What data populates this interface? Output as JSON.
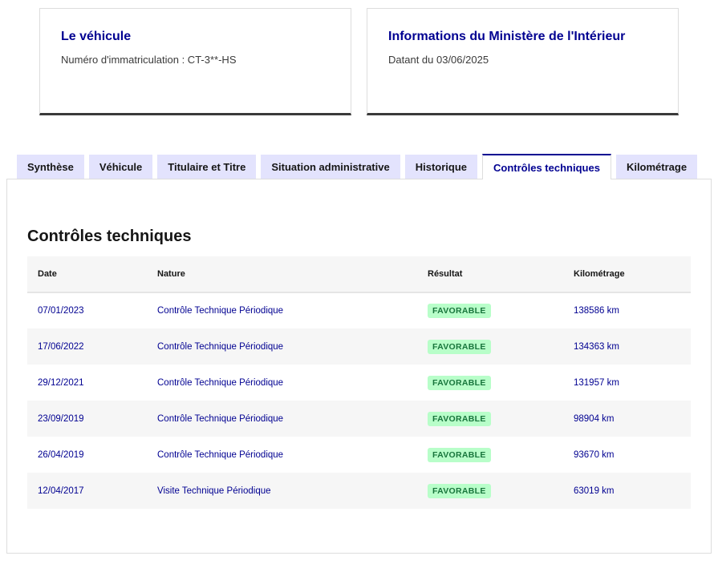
{
  "cards": {
    "vehicle": {
      "title": "Le véhicule",
      "text": "Numéro d'immatriculation : CT-3**-HS"
    },
    "ministry": {
      "title": "Informations du Ministère de l'Intérieur",
      "text": "Datant du 03/06/2025"
    }
  },
  "tabs": [
    {
      "label": "Synthèse"
    },
    {
      "label": "Véhicule"
    },
    {
      "label": "Titulaire et Titre"
    },
    {
      "label": "Situation administrative"
    },
    {
      "label": "Historique"
    },
    {
      "label": "Contrôles techniques"
    },
    {
      "label": "Kilométrage"
    }
  ],
  "active_tab": "Contrôles techniques",
  "section": {
    "title": "Contrôles techniques"
  },
  "table": {
    "headers": {
      "date": "Date",
      "nature": "Nature",
      "result": "Résultat",
      "mileage": "Kilométrage"
    },
    "rows": [
      {
        "date": "07/01/2023",
        "nature": "Contrôle Technique Périodique",
        "result": "FAVORABLE",
        "mileage": "138586 km"
      },
      {
        "date": "17/06/2022",
        "nature": "Contrôle Technique Périodique",
        "result": "FAVORABLE",
        "mileage": "134363 km"
      },
      {
        "date": "29/12/2021",
        "nature": "Contrôle Technique Périodique",
        "result": "FAVORABLE",
        "mileage": "131957 km"
      },
      {
        "date": "23/09/2019",
        "nature": "Contrôle Technique Périodique",
        "result": "FAVORABLE",
        "mileage": "98904 km"
      },
      {
        "date": "26/04/2019",
        "nature": "Contrôle Technique Périodique",
        "result": "FAVORABLE",
        "mileage": "93670 km"
      },
      {
        "date": "12/04/2017",
        "nature": "Visite Technique Périodique",
        "result": "FAVORABLE",
        "mileage": "63019 km"
      }
    ]
  },
  "colors": {
    "accent": "#000091",
    "tab_bg": "#e3e3fd",
    "badge_bg": "#b8fec9",
    "badge_text": "#18753c"
  }
}
